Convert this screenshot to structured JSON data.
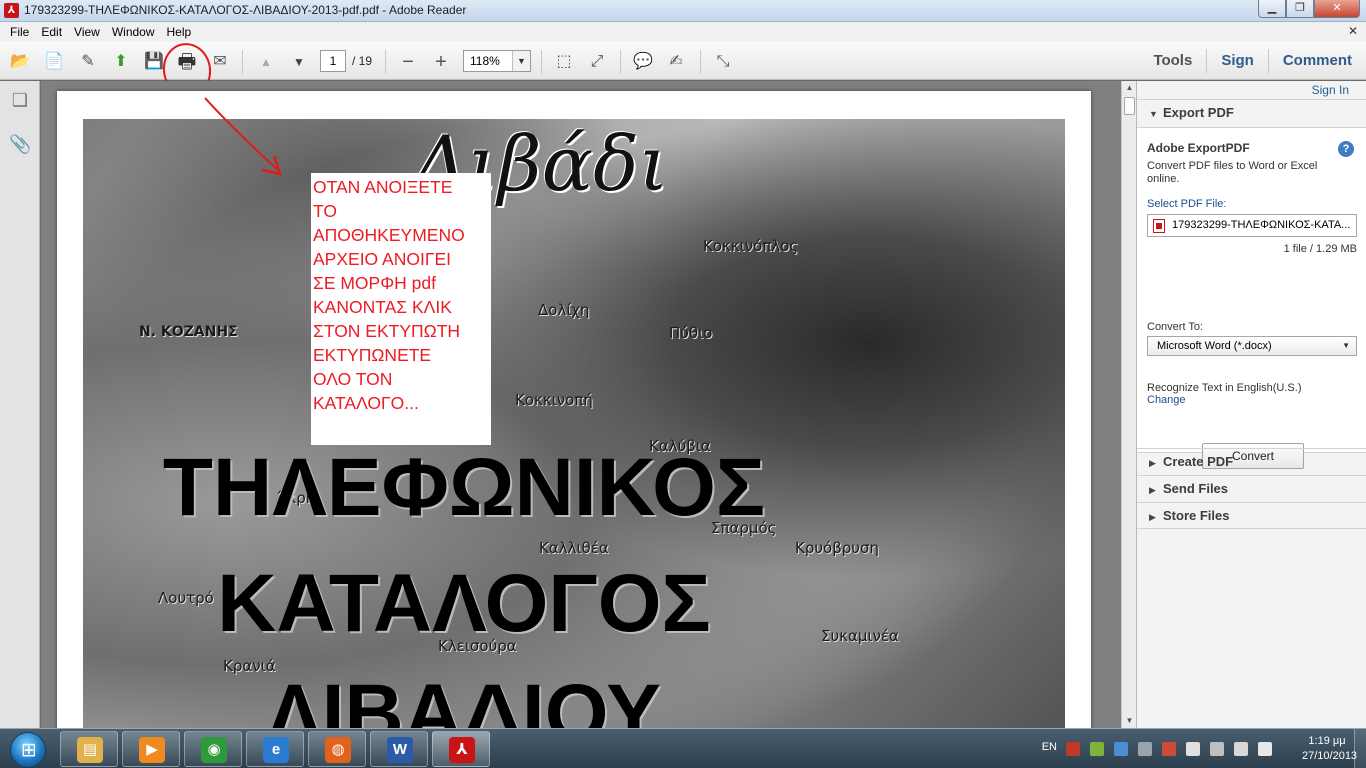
{
  "window": {
    "title": "179323299-ΤΗΛΕΦΩΝΙΚΟΣ-ΚΑΤΑΛΟΓΟΣ-ΛΙΒΑΔΙΟΥ-2013-pdf.pdf - Adobe Reader",
    "minimize_glyph": "▁",
    "restore_glyph": "❐",
    "close_glyph": "✕"
  },
  "menu": {
    "items": [
      "File",
      "Edit",
      "View",
      "Window",
      "Help"
    ],
    "close_glyph": "✕"
  },
  "toolbar": {
    "current_page": "1",
    "total_pages": "/ 19",
    "zoom": "118%",
    "tools_label": "Tools",
    "sign_label": "Sign",
    "comment_label": "Comment",
    "icons": {
      "open": "📂",
      "create": "📄",
      "edit": "✎",
      "upload": "⬆",
      "save": "💾",
      "print": "🖶",
      "email": "✉",
      "prev_page": "▲",
      "next_page": "▼",
      "zoom_out": "−",
      "zoom_in": "+",
      "zoom_arrow": "▼",
      "fit_page": "⬚",
      "fit_width": "⤢",
      "comment": "💬",
      "highlight": "✍",
      "fullscreen": "⤡"
    }
  },
  "leftnav": {
    "pages_glyph": "❏",
    "attachments_glyph": "📎"
  },
  "document": {
    "map_title": "Λιβάδι",
    "places": {
      "kokkinoplos": "Κοκκινόπλος",
      "dolichi": "Δολίχη",
      "kozanis": "Ν. ΚΟΖΑΝΗΣ",
      "pythio": "Πύθιο",
      "kokkinopi": "Κοκκινοπή",
      "kalyvia": "Καλύβια",
      "akri": "Άκρη",
      "sparmos": "Σπαρμός",
      "kallithea": "Καλλιθέα",
      "kryovrysi": "Κρυόβρυση",
      "lotra": "Λουτρό",
      "kleisoura": "Κλεισούρα",
      "sykamia": "Συκαμινέα",
      "krania": "Κρανιά"
    },
    "heading_line1": "ΤΗΛΕΦΩΝΙΚΟΣ",
    "heading_line2": "ΚΑΤΑΛΟΓΟΣ",
    "heading_line3": "ΛΙΒΑΔΙΟΥ",
    "note": "ΟΤΑΝ ΑΝΟΙΞΕΤΕ\nΤΟ\nΑΠΟΘΗΚΕΥΜΕΝΟ\nΑΡΧΕΙΟ ΑΝΟΙΓΕΙ\nΣΕ ΜΟΡΦΗ pdf\nΚΑΝΟΝΤΑΣ ΚΛΙΚ\nΣΤΟΝ ΕΚΤΥΠΩΤΗ\nΕΚΤΥΠΩΝΕΤΕ\nΟΛΟ ΤΟΝ\nΚΑΤΑΛΟΓΟ...",
    "annotation_color": "#e01a1a"
  },
  "scrollbar": {
    "up_glyph": "▲",
    "down_glyph": "▼"
  },
  "right_panel": {
    "sign_in": "Sign In",
    "export_pdf": {
      "header": "Export PDF",
      "title": "Adobe ExportPDF",
      "help_glyph": "?",
      "description": "Convert PDF files to Word or Excel online.",
      "select_label": "Select PDF File:",
      "file_name": "179323299-ΤΗΛΕΦΩΝΙΚΟΣ-ΚΑΤΑ...",
      "file_meta": "1 file / 1.29 MB",
      "convert_to_label": "Convert To:",
      "convert_to_value": "Microsoft Word (*.docx)",
      "select_arrow": "▼",
      "recognize_label": "Recognize Text in English(U.S.)",
      "change_link": "Change",
      "convert_button": "Convert"
    },
    "sections": [
      "Create PDF",
      "Send Files",
      "Store Files"
    ],
    "collapsed_glyph": "▶",
    "expanded_glyph": "▼"
  },
  "taskbar": {
    "apps": [
      {
        "name": "explorer",
        "glyph": "▤",
        "color": "#e0b04a"
      },
      {
        "name": "media-player",
        "glyph": "▶",
        "color": "#f08a1c"
      },
      {
        "name": "chrome",
        "glyph": "◉",
        "color": "#2f9a3b"
      },
      {
        "name": "internet-explorer",
        "glyph": "e",
        "color": "#2c7bd2"
      },
      {
        "name": "firefox",
        "glyph": "◍",
        "color": "#e2621c"
      },
      {
        "name": "word",
        "glyph": "W",
        "color": "#2a5aa8"
      },
      {
        "name": "adobe-reader",
        "glyph": "⅄",
        "color": "#c81414"
      }
    ],
    "language": "EN",
    "time": "1:19 μμ",
    "date": "27/10/2013"
  }
}
